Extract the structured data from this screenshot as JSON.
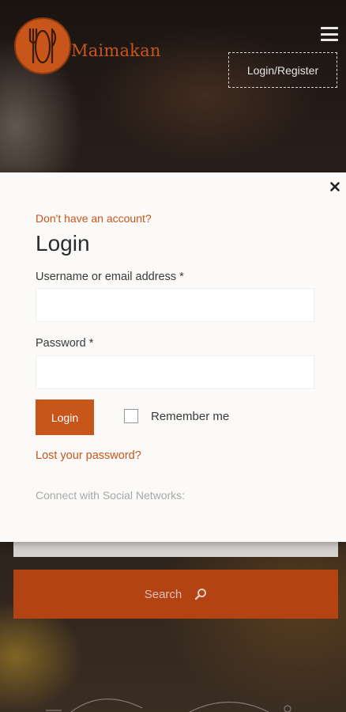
{
  "header": {
    "logo_text": "Maimakan",
    "login_register_label": "Login/Register"
  },
  "background": {
    "search_button_label": "Search"
  },
  "modal": {
    "no_account_link": "Don't have an account?",
    "title": "Login",
    "username_label": "Username or email address *",
    "username_value": "",
    "password_label": "Password *",
    "password_value": "",
    "login_button_label": "Login",
    "remember_label": "Remember me",
    "remember_checked": false,
    "lost_password_link": "Lost your password?",
    "social_text": "Connect with Social Networks:"
  },
  "colors": {
    "accent": "#c8561a",
    "modal_bg": "#fbfaf8",
    "search_button_bg": "#b34312"
  },
  "icons": [
    "menu-icon",
    "close-icon",
    "search-icon",
    "cutlery-icon"
  ]
}
